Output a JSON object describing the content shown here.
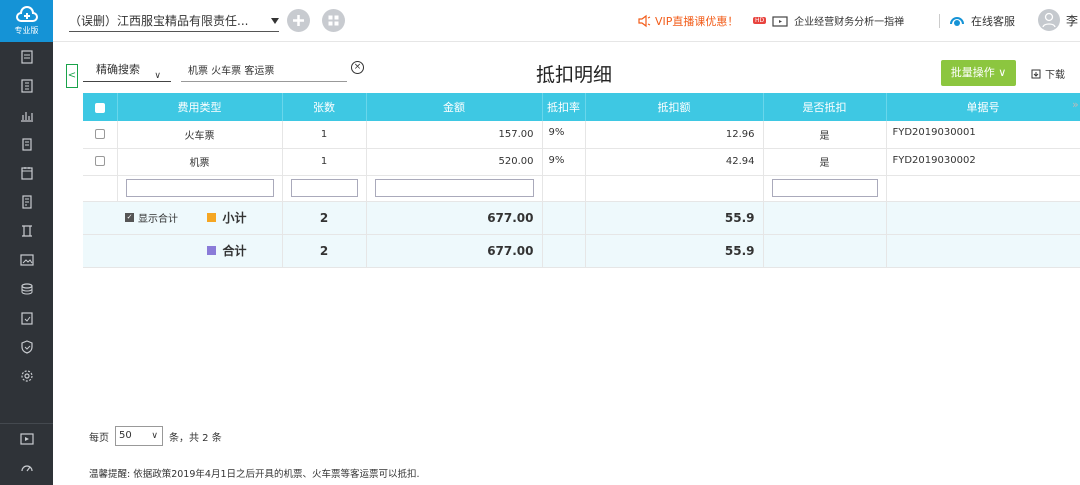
{
  "sidebar": {
    "logo_label": "专业版"
  },
  "topbar": {
    "company": "（误删）江西服宝精品有限责任...",
    "vip_text": "VIP直播课优惠！",
    "hd_badge": "HD",
    "news_text": "企业经营财务分析一指禅",
    "service_text": "在线客服",
    "user_name": "李"
  },
  "filter": {
    "search_type": "精确搜索",
    "search_value": "机票 火车票 客运票",
    "clear_icon": "⊗"
  },
  "page": {
    "title": "抵扣明细",
    "batch_label": "批量操作",
    "download_label": "下载"
  },
  "table": {
    "headers": [
      "费用类型",
      "张数",
      "金额",
      "抵扣率",
      "抵扣额",
      "是否抵扣",
      "单据号"
    ],
    "rows": [
      {
        "type": "火车票",
        "count": "1",
        "amount": "157.00",
        "rate": "9%",
        "deduct": "12.96",
        "is_deduct": "是",
        "doc_no": "FYD2019030001"
      },
      {
        "type": "机票",
        "count": "1",
        "amount": "520.00",
        "rate": "9%",
        "deduct": "42.94",
        "is_deduct": "是",
        "doc_no": "FYD2019030002"
      }
    ],
    "show_total_label": "显示合计",
    "subtotal": {
      "label": "小计",
      "count": "2",
      "amount": "677.00",
      "deduct": "55.9"
    },
    "total": {
      "label": "合计",
      "count": "2",
      "amount": "677.00",
      "deduct": "55.9"
    }
  },
  "pager": {
    "per_page_label": "每页",
    "per_page_value": "50",
    "count_text": "条，共 2 条"
  },
  "note": "温馨提醒: 依据政策2019年4月1日之后开具的机票、火车票等客运票可以抵扣.",
  "colors": {
    "sidebar": "#2f3338",
    "logo": "#1593d6",
    "header": "#3ec8e3",
    "batch": "#8cc63f",
    "vip": "#f25c19"
  }
}
